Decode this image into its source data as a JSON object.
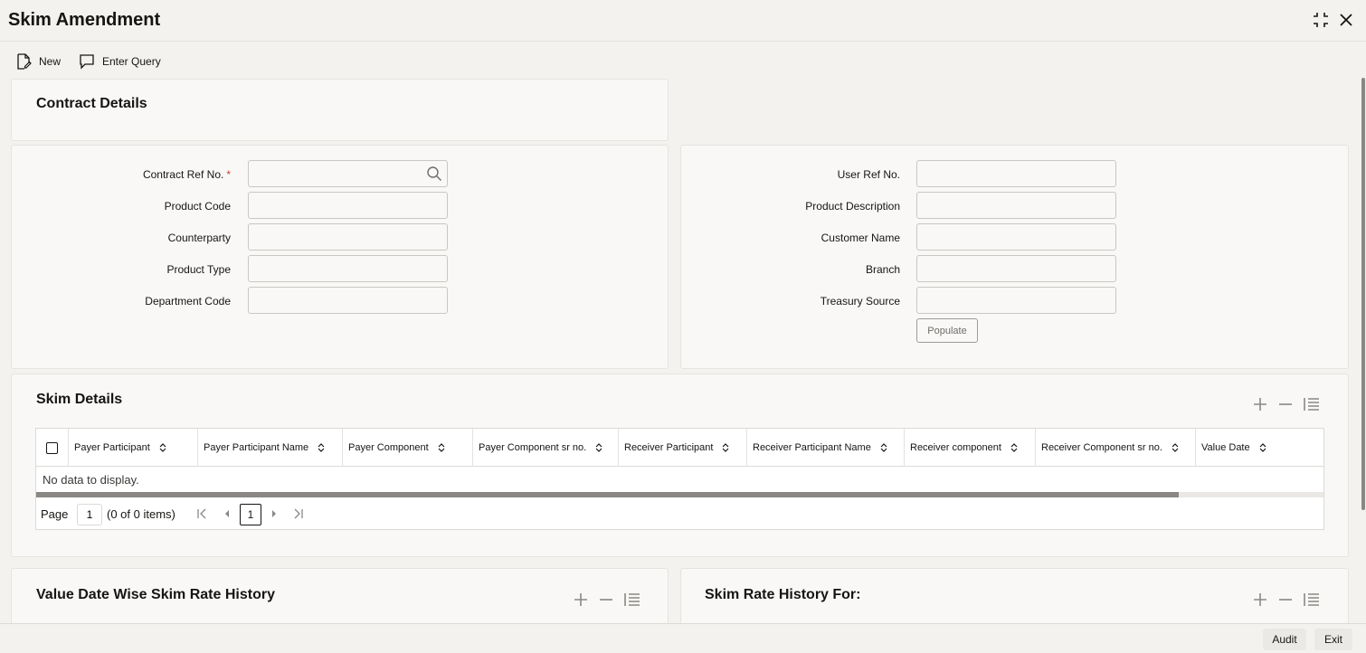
{
  "window": {
    "title": "Skim Amendment",
    "collapse_icon": "collapse-icon",
    "close_icon": "close-icon"
  },
  "toolbar": {
    "new_label": "New",
    "enter_query_label": "Enter Query"
  },
  "contract_details": {
    "title": "Contract Details",
    "left_fields": [
      {
        "label": "Contract Ref No.",
        "required": "*",
        "value": ""
      },
      {
        "label": "Product Code",
        "value": ""
      },
      {
        "label": "Counterparty",
        "value": ""
      },
      {
        "label": "Product Type",
        "value": ""
      },
      {
        "label": "Department Code",
        "value": ""
      }
    ],
    "right_fields": [
      {
        "label": "User Ref No.",
        "value": ""
      },
      {
        "label": "Product Description",
        "value": ""
      },
      {
        "label": "Customer Name",
        "value": ""
      },
      {
        "label": "Branch",
        "value": ""
      },
      {
        "label": "Treasury Source",
        "value": ""
      }
    ],
    "populate_label": "Populate"
  },
  "skim_details": {
    "title": "Skim Details",
    "columns": [
      "Payer Participant",
      "Payer Participant Name",
      "Payer Component",
      "Payer Component sr no.",
      "Receiver Participant",
      "Receiver Participant Name",
      "Receiver component",
      "Receiver Component sr no.",
      "Value Date"
    ],
    "no_data": "No data to display.",
    "pager": {
      "page_label": "Page",
      "page_value": "1",
      "count": "(0 of 0 items)",
      "current": "1"
    }
  },
  "value_date_history": {
    "title": "Value Date Wise Skim Rate History"
  },
  "rate_history_for": {
    "title": "Skim Rate History For:"
  },
  "footer": {
    "audit_label": "Audit",
    "exit_label": "Exit"
  }
}
